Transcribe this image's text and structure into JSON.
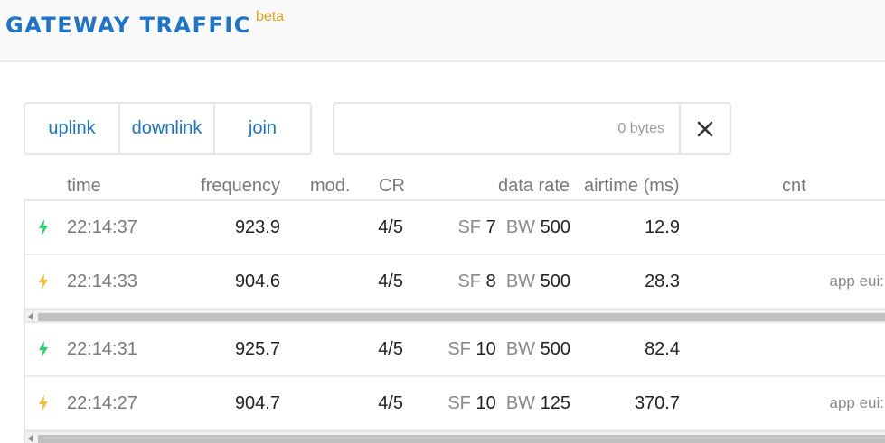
{
  "header": {
    "title": "GATEWAY TRAFFIC",
    "badge": "beta"
  },
  "filters": {
    "uplink": "uplink",
    "downlink": "downlink",
    "join": "join"
  },
  "bytes": {
    "placeholder": "0 bytes",
    "clear_icon": "close-icon"
  },
  "columns": {
    "time": "time",
    "frequency": "frequency",
    "mod": "mod.",
    "cr": "CR",
    "data_rate": "data rate",
    "airtime": "airtime (ms)",
    "cnt": "cnt"
  },
  "colors": {
    "accent": "#1e74c9",
    "beta": "#e8a317",
    "uplink_icon": "#27d36a",
    "downlink_icon": "#f2c230"
  },
  "rows": [
    {
      "icon": "lightning-icon",
      "direction": "uplink",
      "time": "22:14:37",
      "frequency": "923.9",
      "cr": "4/5",
      "sf_label": "SF",
      "sf": "7",
      "bw_label": "BW",
      "bw": "500",
      "airtime": "12.9",
      "extra": ""
    },
    {
      "icon": "lightning-icon",
      "direction": "downlink",
      "time": "22:14:33",
      "frequency": "904.6",
      "cr": "4/5",
      "sf_label": "SF",
      "sf": "8",
      "bw_label": "BW",
      "bw": "500",
      "airtime": "28.3",
      "extra": "app eui:"
    },
    {
      "icon": "lightning-icon",
      "direction": "uplink",
      "time": "22:14:31",
      "frequency": "925.7",
      "cr": "4/5",
      "sf_label": "SF",
      "sf": "10",
      "bw_label": "BW",
      "bw": "500",
      "airtime": "82.4",
      "extra": ""
    },
    {
      "icon": "lightning-icon",
      "direction": "downlink",
      "time": "22:14:27",
      "frequency": "904.7",
      "cr": "4/5",
      "sf_label": "SF",
      "sf": "10",
      "bw_label": "BW",
      "bw": "125",
      "airtime": "370.7",
      "extra": "app eui:"
    }
  ]
}
